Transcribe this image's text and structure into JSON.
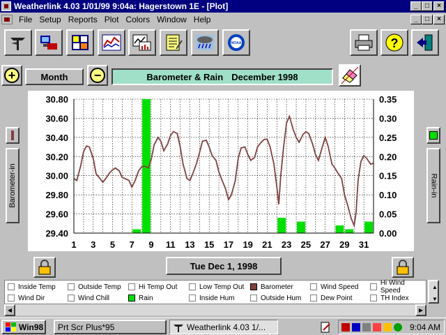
{
  "window": {
    "title": "Weatherlink 4.03   1/01/99   9:04a: Hagerstown 1E - [Plot]",
    "controls": [
      "_",
      "□",
      "×"
    ]
  },
  "menu": {
    "items": [
      "File",
      "Setup",
      "Reports",
      "Plot",
      "Colors",
      "Window",
      "Help"
    ]
  },
  "toolbar": {
    "buttons": [
      "station-icon",
      "connect-icon",
      "summary-icon",
      "plot-icon",
      "strip-chart-icon",
      "notepad-icon",
      "weather-icon",
      "noaa-icon",
      "printer-icon",
      "help-icon",
      "exit-icon"
    ],
    "noaa_label": "NOAA",
    "help_label": "?"
  },
  "controls": {
    "zoom_in": "+",
    "zoom_out": "−",
    "period_label": "Month",
    "chart_title_left": "Barometer & Rain",
    "chart_title_right": "December 1998",
    "date_label": "Tue Dec 1, 1998",
    "left_axis_button": "Barometer-in",
    "right_axis_button": "Rain-in",
    "left_swatch_color": "#804040",
    "right_swatch_color": "#00e000"
  },
  "legend": {
    "items": [
      {
        "label": "Inside Temp",
        "checked": false,
        "color": ""
      },
      {
        "label": "Outside Temp",
        "checked": false,
        "color": ""
      },
      {
        "label": "Hi Temp Out",
        "checked": false,
        "color": ""
      },
      {
        "label": "Low Temp Out",
        "checked": false,
        "color": ""
      },
      {
        "label": "Barometer",
        "checked": true,
        "color": "#804040"
      },
      {
        "label": "Wind Speed",
        "checked": false,
        "color": ""
      },
      {
        "label": "Hi Wind Speed",
        "checked": false,
        "color": ""
      },
      {
        "label": "Wind Dir",
        "checked": false,
        "color": ""
      },
      {
        "label": "Wind Chill",
        "checked": false,
        "color": ""
      },
      {
        "label": "Rain",
        "checked": true,
        "color": "#00e000"
      },
      {
        "label": "Inside Hum",
        "checked": false,
        "color": ""
      },
      {
        "label": "Outside Hum",
        "checked": false,
        "color": ""
      },
      {
        "label": "Dew Point",
        "checked": false,
        "color": ""
      },
      {
        "label": "TH Index",
        "checked": false,
        "color": ""
      }
    ]
  },
  "taskbar": {
    "start": "Win98",
    "tasks": [
      "Prt Scr Plus*95",
      "Weatherlink 4.03   1/..."
    ],
    "clock": "9:04 AM"
  },
  "chart_data": {
    "type": "bar+line",
    "x_ticks": [
      "1",
      "3",
      "5",
      "7",
      "9",
      "11",
      "13",
      "15",
      "17",
      "19",
      "21",
      "23",
      "25",
      "27",
      "29",
      "31"
    ],
    "xlim": [
      1,
      32
    ],
    "left_axis": {
      "ticks": [
        "30.80",
        "30.60",
        "30.40",
        "30.20",
        "30.00",
        "29.80",
        "29.60",
        "29.40"
      ],
      "ylim": [
        29.4,
        30.8
      ]
    },
    "right_axis": {
      "ticks": [
        "0.35",
        "0.30",
        "0.25",
        "0.20",
        "0.15",
        "0.10",
        "0.05",
        "0.00"
      ],
      "ylim": [
        0,
        0.35
      ]
    },
    "grid": true,
    "rain": {
      "color": "#00e000",
      "days": [
        7,
        8,
        22,
        24,
        28,
        29,
        31
      ],
      "values": [
        0.01,
        0.35,
        0.04,
        0.03,
        0.02,
        0.01,
        0.03
      ]
    },
    "barometer": {
      "color": "#804040",
      "x": [
        1,
        1.3,
        1.7,
        2,
        2.3,
        2.6,
        3,
        3.3,
        3.7,
        4,
        4.3,
        4.7,
        5,
        5.3,
        5.7,
        6,
        6.3,
        6.7,
        7,
        7.3,
        7.7,
        8,
        8.3,
        8.7,
        9,
        9.3,
        9.7,
        10,
        10.3,
        10.7,
        11,
        11.3,
        11.7,
        12,
        12.3,
        12.7,
        13,
        13.3,
        13.7,
        14,
        14.3,
        14.7,
        15,
        15.3,
        15.7,
        16,
        16.3,
        16.7,
        17,
        17.3,
        17.7,
        18,
        18.3,
        18.7,
        19,
        19.3,
        19.7,
        20,
        20.3,
        20.7,
        21,
        21.3,
        21.7,
        22,
        22.2,
        22.4,
        22.7,
        23,
        23.3,
        23.7,
        24,
        24.3,
        24.7,
        25,
        25.3,
        25.7,
        26,
        26.3,
        26.7,
        27,
        27.3,
        27.7,
        28,
        28.3,
        28.7,
        29,
        29.3,
        29.7,
        30,
        30.2,
        30.4,
        30.7,
        31,
        31.3,
        31.7,
        32
      ],
      "y": [
        29.97,
        29.95,
        30.1,
        30.25,
        30.31,
        30.3,
        30.18,
        30.02,
        29.97,
        29.93,
        29.97,
        30.03,
        30.06,
        30.08,
        30.05,
        29.98,
        29.97,
        29.95,
        29.88,
        29.94,
        30.05,
        30.09,
        30.1,
        30.08,
        30.17,
        30.32,
        30.4,
        30.36,
        30.26,
        30.33,
        30.42,
        30.46,
        30.44,
        30.3,
        30.12,
        29.97,
        29.95,
        30.02,
        30.13,
        30.24,
        30.36,
        30.37,
        30.3,
        30.21,
        30.16,
        30.04,
        29.96,
        29.86,
        29.75,
        29.8,
        29.95,
        30.18,
        30.29,
        30.3,
        30.22,
        30.16,
        30.19,
        30.3,
        30.34,
        30.38,
        30.38,
        30.3,
        30.12,
        29.88,
        29.7,
        30.0,
        30.3,
        30.55,
        30.62,
        30.48,
        30.4,
        30.35,
        30.43,
        30.46,
        30.44,
        30.33,
        30.22,
        30.16,
        30.3,
        30.4,
        30.31,
        30.12,
        30.08,
        30.03,
        29.97,
        29.8,
        29.7,
        29.55,
        29.48,
        29.62,
        29.95,
        30.15,
        30.21,
        30.18,
        30.12,
        30.13,
        30.15
      ]
    }
  }
}
